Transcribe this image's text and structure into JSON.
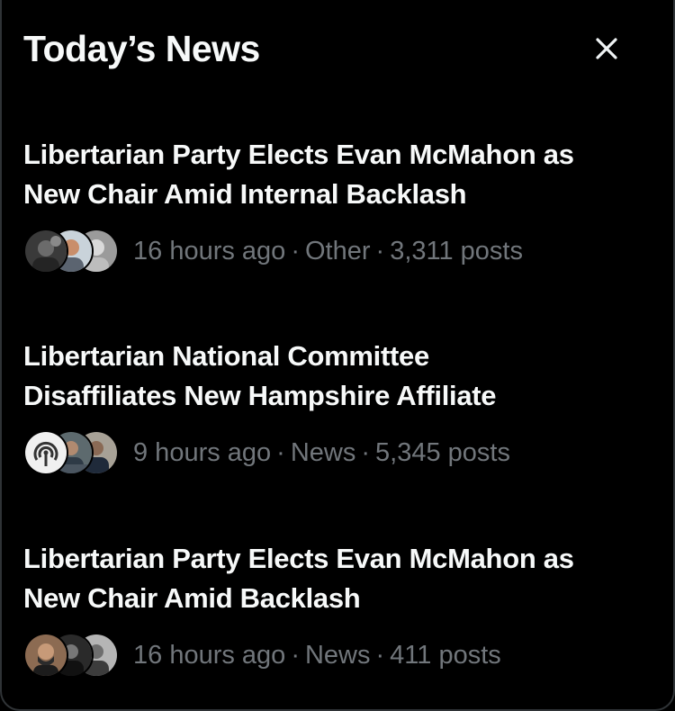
{
  "header": {
    "title": "Today’s News",
    "close_icon": "close-icon"
  },
  "stories": [
    {
      "title_line1": "Libertarian Party Elects Evan McMahon as",
      "title_line2": "New Chair Amid Internal Backlash",
      "time": "16 hours ago",
      "category": "Other",
      "posts": "3,311 posts",
      "separator": "·"
    },
    {
      "title_line1": "Libertarian National Committee",
      "title_line2": "Disaffiliates New Hampshire Affiliate",
      "time": "9 hours ago",
      "category": "News",
      "posts": "5,345 posts",
      "separator": "·"
    },
    {
      "title_line1": "Libertarian Party Elects Evan McMahon as",
      "title_line2": "New Chair Amid Backlash",
      "time": "16 hours ago",
      "category": "News",
      "posts": "411 posts",
      "separator": "·"
    }
  ],
  "colors": {
    "background": "#000000",
    "title_text": "#f7f9f9",
    "meta_text": "#71767b",
    "border": "#2f3336"
  }
}
